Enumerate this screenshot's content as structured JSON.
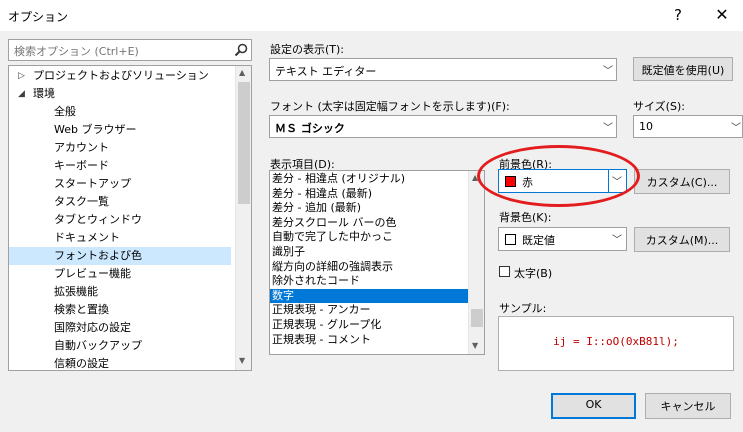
{
  "window": {
    "title": "オプション",
    "help_label": "?",
    "close_label": "✕"
  },
  "search": {
    "placeholder": "検索オプション (Ctrl+E)"
  },
  "tree": {
    "items": [
      {
        "label": "プロジェクトおよびソリューション",
        "expander": "▷",
        "level": 1
      },
      {
        "label": "環境",
        "expander": "◢",
        "level": 1
      },
      {
        "label": "全般",
        "level": 2
      },
      {
        "label": "Web ブラウザー",
        "level": 2
      },
      {
        "label": "アカウント",
        "level": 2
      },
      {
        "label": "キーボード",
        "level": 2
      },
      {
        "label": "スタートアップ",
        "level": 2
      },
      {
        "label": "タスク一覧",
        "level": 2
      },
      {
        "label": "タブとウィンドウ",
        "level": 2
      },
      {
        "label": "ドキュメント",
        "level": 2
      },
      {
        "label": "フォントおよび色",
        "level": 2,
        "selected": true
      },
      {
        "label": "プレビュー機能",
        "level": 2
      },
      {
        "label": "拡張機能",
        "level": 2
      },
      {
        "label": "検索と置換",
        "level": 2
      },
      {
        "label": "国際対応の設定",
        "level": 2
      },
      {
        "label": "自動バックアップ",
        "level": 2
      },
      {
        "label": "信頼の設定",
        "level": 2
      }
    ]
  },
  "settings": {
    "display_label": "設定の表示(T):",
    "display_value": "テキスト エディター",
    "use_defaults_button": "既定値を使用(U)"
  },
  "font": {
    "label": "フォント (太字は固定幅フォントを示します)(F):",
    "value": "ＭＳ ゴシック",
    "size_label": "サイズ(S):",
    "size_value": "10"
  },
  "display_items": {
    "label": "表示項目(D):",
    "items": [
      "差分 - 相違点 (オリジナル)",
      "差分 - 相違点 (最新)",
      "差分 - 追加 (最新)",
      "差分スクロール バーの色",
      "自動で完了した中かっこ",
      "識別子",
      "縦方向の詳細の強調表示",
      "除外されたコード",
      "数字",
      "正規表現 - アンカー",
      "正規表現 - グループ化",
      "正規表現 - コメント"
    ],
    "selected_index": 8
  },
  "foreground": {
    "label": "前景色(R):",
    "value": "赤",
    "swatch_color": "#ff0000",
    "custom_button": "カスタム(C)..."
  },
  "background": {
    "label": "背景色(K):",
    "value": "既定値",
    "swatch_color": "#ffffff",
    "custom_button": "カスタム(M)..."
  },
  "bold": {
    "label": "太字(B)",
    "checked": false
  },
  "sample": {
    "label": "サンプル:",
    "text": "ij = I::oO(0xB81l);",
    "text_color": "#c00000"
  },
  "buttons": {
    "ok": "OK",
    "cancel": "キャンセル"
  },
  "colors": {
    "selection_highlight": "#0078d7",
    "tree_selection": "#cce8ff",
    "annotation_circle": "#e31d1d"
  }
}
